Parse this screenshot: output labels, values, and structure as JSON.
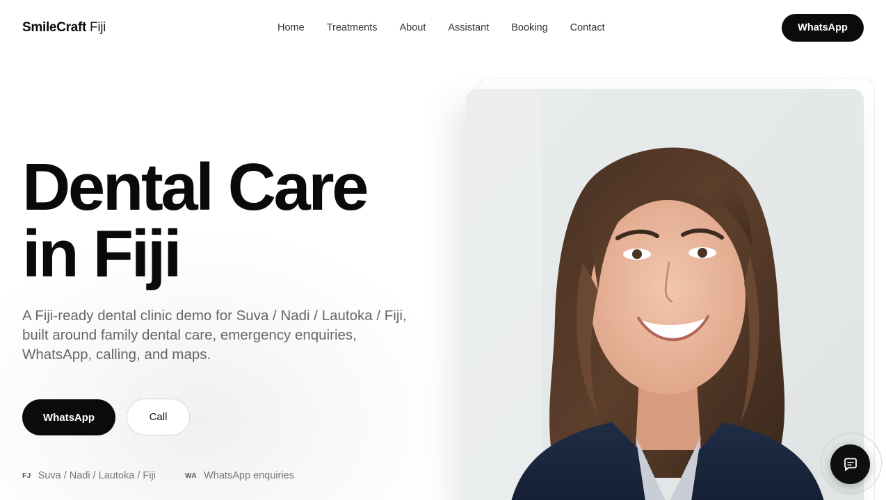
{
  "header": {
    "logo_brand": "SmileCraft",
    "logo_location": "Fiji",
    "nav": [
      {
        "label": "Home"
      },
      {
        "label": "Treatments"
      },
      {
        "label": "About"
      },
      {
        "label": "Assistant"
      },
      {
        "label": "Booking"
      },
      {
        "label": "Contact"
      }
    ],
    "cta_label": "WhatsApp"
  },
  "hero": {
    "title_line1": "Dental Care",
    "title_line2": "in Fiji",
    "subtitle": "A Fiji-ready dental clinic demo for Suva / Nadi / Lautoka / Fiji, built around family dental care, emergency enquiries, WhatsApp, calling, and maps.",
    "primary_button": "WhatsApp",
    "secondary_button": "Call",
    "meta": [
      {
        "code": "FJ",
        "text": "Suva / Nadi / Lautoka / Fiji"
      },
      {
        "code": "WA",
        "text": "WhatsApp enquiries"
      }
    ]
  },
  "image": {
    "subject": "smiling woman with shoulder-length wavy brown hair in a navy blazer"
  },
  "chat_widget": {
    "icon": "chat-bubble-icon"
  },
  "colors": {
    "primary_dark": "#0b0b0b",
    "text_muted": "#666666",
    "background": "#ffffff"
  }
}
